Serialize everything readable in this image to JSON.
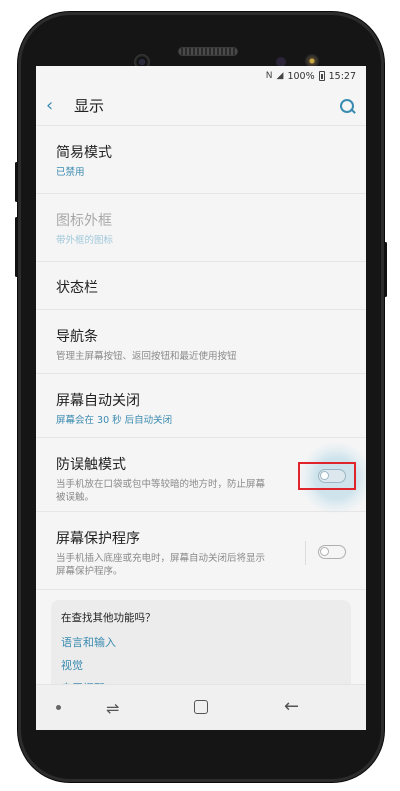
{
  "status_bar": {
    "battery": "100%",
    "time": "15:27"
  },
  "header": {
    "title": "显示"
  },
  "items": [
    {
      "title": "简易模式",
      "subtitle": "已禁用"
    },
    {
      "title": "图标外框",
      "subtitle": "带外框的图标"
    },
    {
      "title": "状态栏"
    },
    {
      "title": "导航条",
      "subtitle": "管理主屏幕按钮、返回按钮和最近使用按钮"
    },
    {
      "title": "屏幕自动关闭",
      "subtitle": "屏幕会在 30 秒 后自动关闭"
    },
    {
      "title": "防误触模式",
      "subtitle": "当手机放在口袋或包中等较暗的地方时，防止屏幕被误触。",
      "toggle_on": false
    },
    {
      "title": "屏幕保护程序",
      "subtitle": "当手机插入底座或充电时，屏幕自动关闭后将显示屏幕保护程序。",
      "toggle_on": false
    }
  ],
  "suggestions": {
    "title": "在查找其他功能吗？",
    "links": [
      "语言和输入",
      "视觉",
      "息屏提醒"
    ]
  },
  "colors": {
    "accent": "#3a8bb0",
    "highlight_box": "#e0242b"
  }
}
